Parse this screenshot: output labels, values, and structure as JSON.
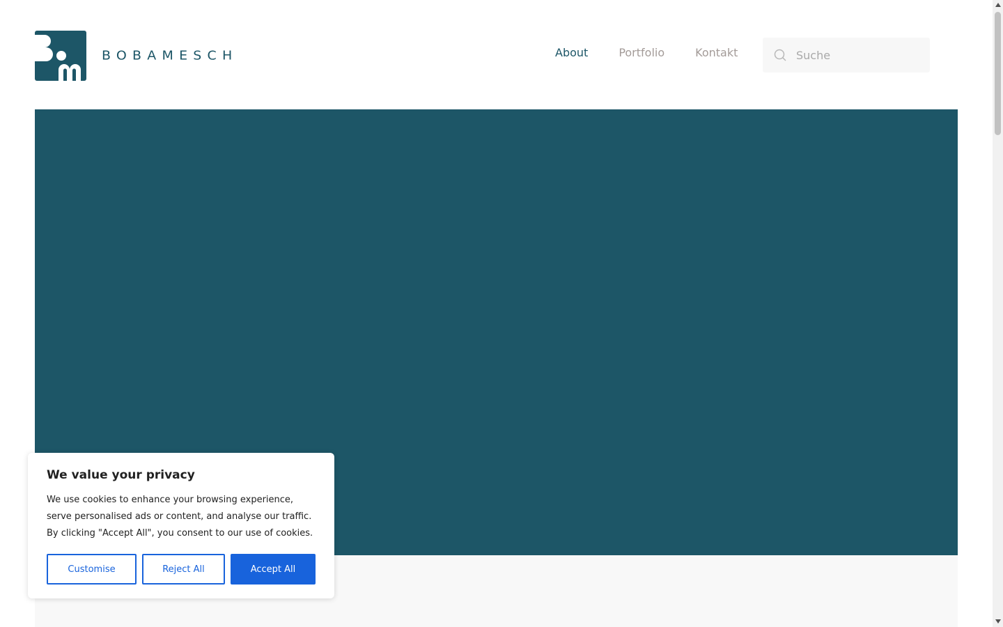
{
  "brand": {
    "wordmark": "BOBAMESCH",
    "accent_color": "#1d5667"
  },
  "nav": {
    "items": [
      {
        "label": "About",
        "active": true
      },
      {
        "label": "Portfolio",
        "active": false
      },
      {
        "label": "Kontakt",
        "active": false
      }
    ]
  },
  "search": {
    "placeholder": "Suche",
    "icon": "search-icon"
  },
  "hero": {
    "color": "#1d5667"
  },
  "cookie": {
    "title": "We value your privacy",
    "text": "We use cookies to enhance your browsing experience, serve personalised ads or content, and analyse our traffic. By clicking \"Accept All\", you consent to our use of cookies.",
    "buttons": {
      "customise": "Customise",
      "reject": "Reject All",
      "accept": "Accept All"
    },
    "accent_color": "#1863dc"
  }
}
